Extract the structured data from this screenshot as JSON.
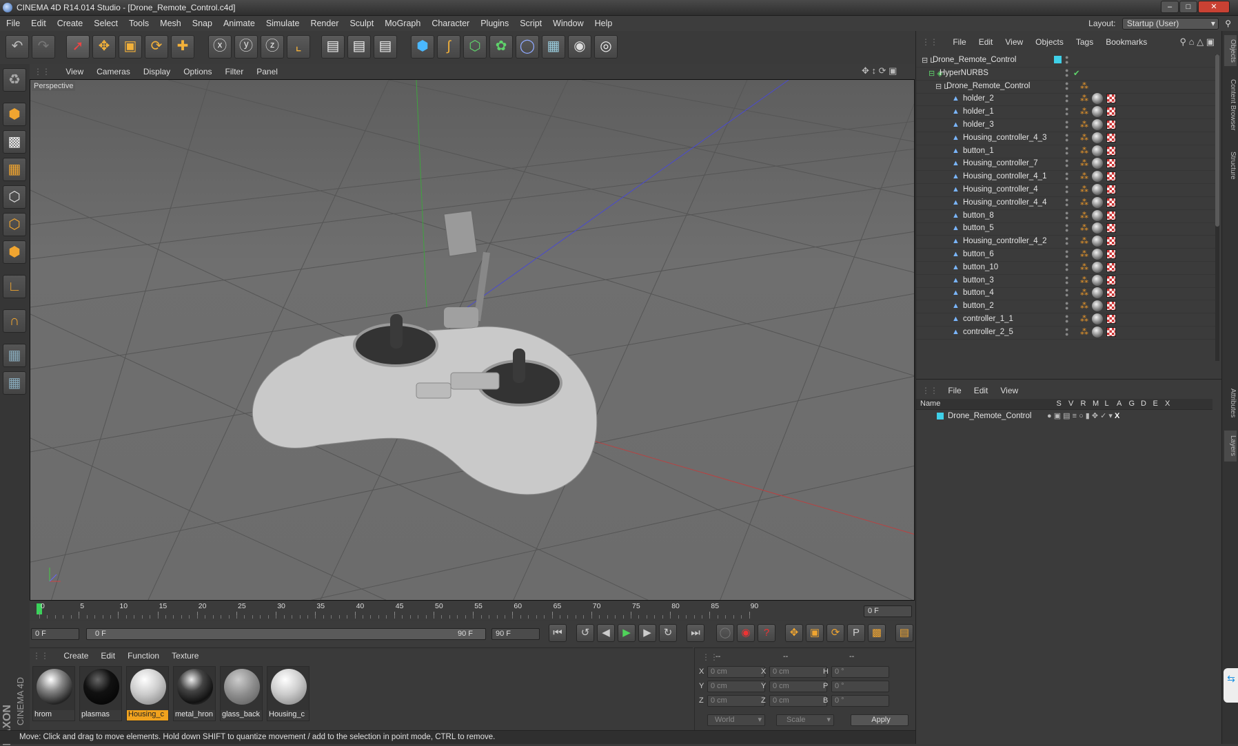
{
  "window": {
    "title": "CINEMA 4D R14.014 Studio - [Drone_Remote_Control.c4d]"
  },
  "menu": [
    "File",
    "Edit",
    "Create",
    "Select",
    "Tools",
    "Mesh",
    "Snap",
    "Animate",
    "Simulate",
    "Render",
    "Sculpt",
    "MoGraph",
    "Character",
    "Plugins",
    "Script",
    "Window",
    "Help"
  ],
  "layout": {
    "label": "Layout:",
    "value": "Startup (User)"
  },
  "viewport": {
    "menu": [
      "View",
      "Cameras",
      "Display",
      "Options",
      "Filter",
      "Panel"
    ],
    "label": "Perspective"
  },
  "timeline": {
    "ticks": [
      "0",
      "5",
      "10",
      "15",
      "20",
      "25",
      "30",
      "35",
      "40",
      "45",
      "50",
      "55",
      "60",
      "65",
      "70",
      "75",
      "80",
      "85",
      "90"
    ],
    "end_frame": "0 F",
    "current": "0 F",
    "range_start": "0 F",
    "range_end": "90 F",
    "max": "90 F"
  },
  "materials": {
    "menu": [
      "Create",
      "Edit",
      "Function",
      "Texture"
    ],
    "items": [
      {
        "name": "hrom",
        "style": "chrome"
      },
      {
        "name": "plasmas",
        "style": "black"
      },
      {
        "name": "Housing_c",
        "style": "white",
        "selected": true
      },
      {
        "name": "metal_hron",
        "style": "darkchrome"
      },
      {
        "name": "glass_back",
        "style": "glass"
      },
      {
        "name": "Housing_c",
        "style": "white"
      }
    ]
  },
  "coords": {
    "headers": [
      "--",
      "--",
      "--"
    ],
    "rows": [
      {
        "a": "X",
        "av": "0 cm",
        "b": "X",
        "bv": "0 cm",
        "c": "H",
        "cv": "0 °"
      },
      {
        "a": "Y",
        "av": "0 cm",
        "b": "Y",
        "bv": "0 cm",
        "c": "P",
        "cv": "0 °"
      },
      {
        "a": "Z",
        "av": "0 cm",
        "b": "Z",
        "bv": "0 cm",
        "c": "B",
        "cv": "0 °"
      }
    ],
    "space": "World",
    "mode": "Scale",
    "apply": "Apply"
  },
  "status": "Move: Click and drag to move elements. Hold down SHIFT to quantize movement / add to the selection in point mode, CTRL to remove.",
  "objects": {
    "menu": [
      "File",
      "Edit",
      "View",
      "Objects",
      "Tags",
      "Bookmarks"
    ],
    "root": "Drone_Remote_Control",
    "hypernurbs": "HyperNURBS",
    "group": "Drone_Remote_Control",
    "items": [
      "holder_2",
      "holder_1",
      "holder_3",
      "Housing_controller_4_3",
      "button_1",
      "Housing_controller_7",
      "Housing_controller_4_1",
      "Housing_controller_4",
      "Housing_controller_4_4",
      "button_8",
      "button_5",
      "Housing_controller_4_2",
      "button_6",
      "button_10",
      "button_3",
      "button_4",
      "button_2",
      "controller_1_1",
      "controller_2_5"
    ]
  },
  "layers": {
    "menu": [
      "File",
      "Edit",
      "View"
    ],
    "columns": [
      "Name",
      "S",
      "V",
      "R",
      "M",
      "L",
      "A",
      "G",
      "D",
      "E",
      "X"
    ],
    "row": "Drone_Remote_Control"
  },
  "side_tabs": [
    "Objects",
    "Content Browser",
    "Structure",
    "Attributes",
    "Layers"
  ],
  "brand": {
    "maxon": "MAXON",
    "product": "CINEMA 4D"
  }
}
